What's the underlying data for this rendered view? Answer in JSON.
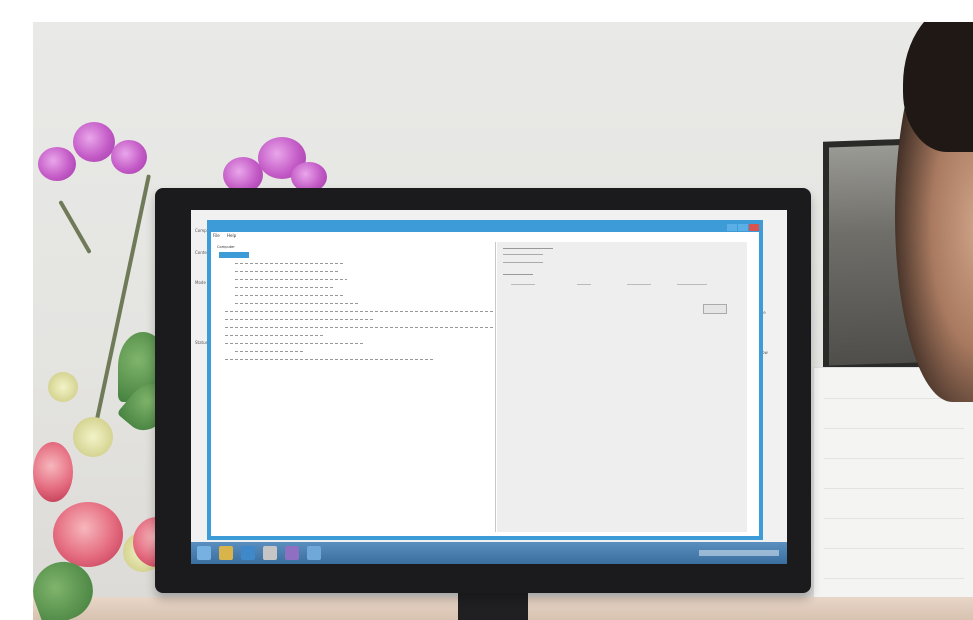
{
  "scene": {
    "description_tags": [
      "orchids-icon",
      "roses-icon",
      "monitor",
      "person"
    ],
    "colors": {
      "wall": "#e6e6e3",
      "window_accent": "#3d9bd8",
      "taskbar": "#4a7faf",
      "orchid": "#c45bc7",
      "rose": "#e46a7e"
    }
  },
  "screen": {
    "window_title": "",
    "menu": [
      "File",
      "Help"
    ],
    "tree_top_label": "Computer",
    "selected_item": "",
    "right_pane": {
      "header": "",
      "columns": [
        "",
        "",
        "",
        ""
      ],
      "button_label": ""
    }
  }
}
